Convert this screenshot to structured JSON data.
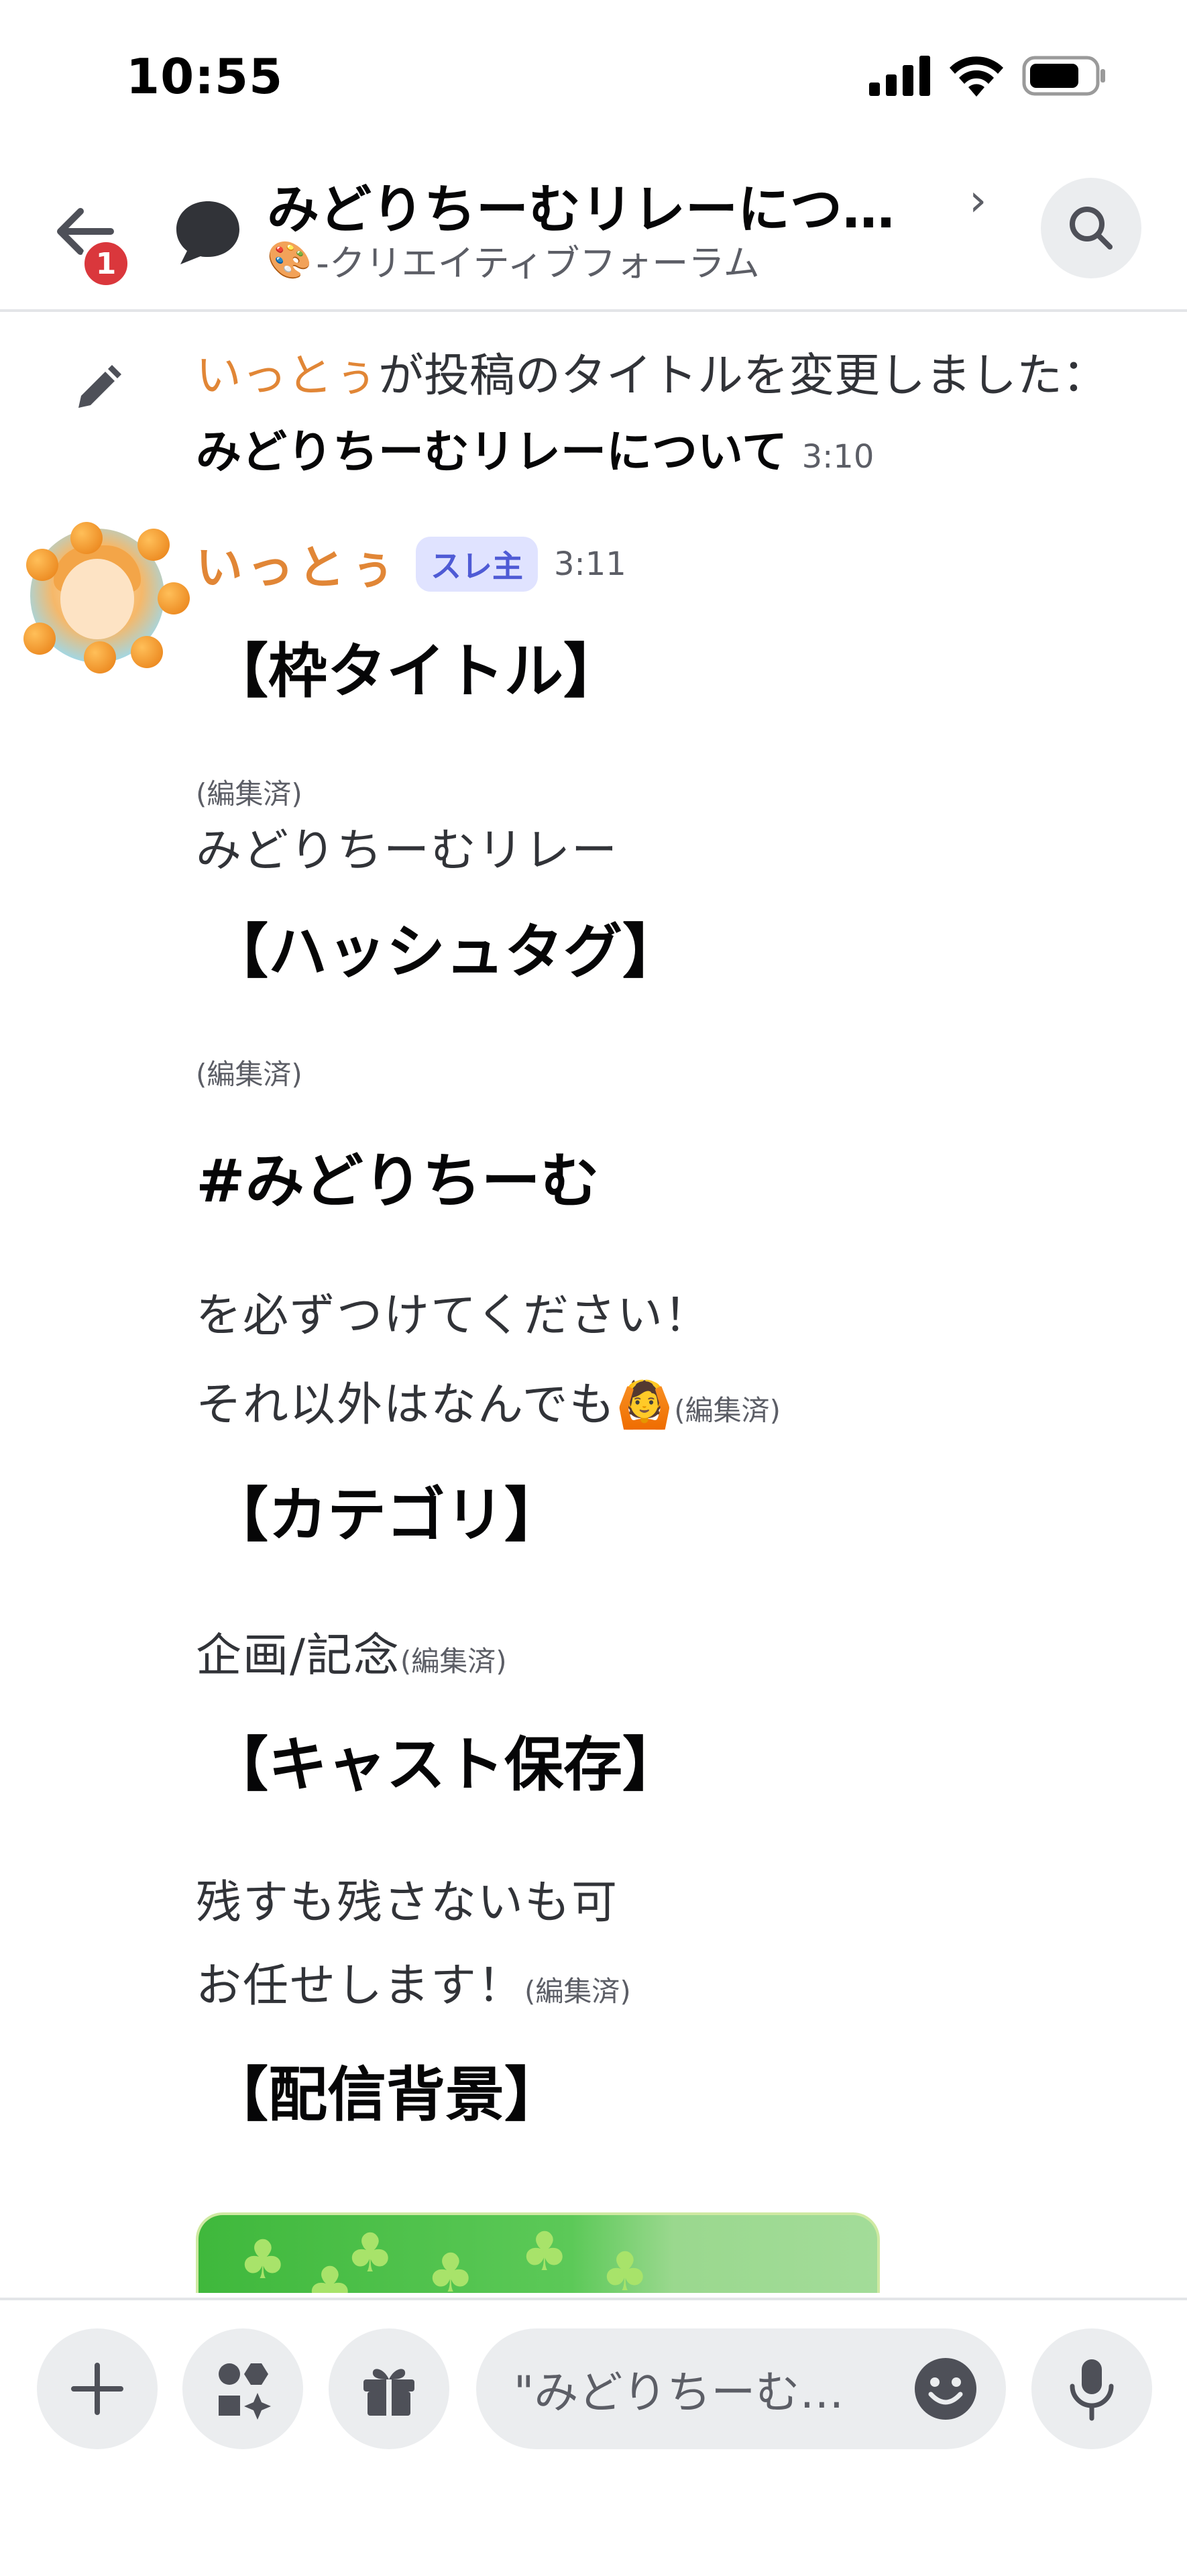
{
  "status_bar": {
    "time": "10:55",
    "icons": [
      "signal-icon",
      "wifi-icon",
      "battery-icon"
    ]
  },
  "header": {
    "back_badge": "1",
    "title": "みどりちーむリレーにつ…",
    "channel_icon": "🎨",
    "channel": "-クリエイティブフォーラム",
    "chevron": "›"
  },
  "system_message": {
    "actor": "いっとぅ",
    "action": "が投稿のタイトルを変更しました：",
    "new_title": "みどりちーむリレーについて",
    "time": "3:10"
  },
  "post": {
    "author": "いっとぅ",
    "badge": "スレ主",
    "time": "3:11",
    "edited_label": "(編集済)",
    "sections": {
      "frame_title_heading": "【枠タイトル】",
      "frame_title_value": "みどりちーむリレー",
      "hashtag_heading": "【ハッシュタグ】",
      "hashtag_value": "#みどりちーむ",
      "hashtag_note1": "を必ずつけてください！",
      "hashtag_note2": "それ以外はなんでも",
      "hashtag_emoji": "🙆",
      "category_heading": "【カテゴリ】",
      "category_value": "企画/記念",
      "cast_heading": "【キャスト保存】",
      "cast_line1": "残すも残さないも可",
      "cast_line2": "お任せします！",
      "background_heading": "【配信背景】"
    }
  },
  "composer": {
    "placeholder": "\"みどりちーむ…",
    "colors": {
      "accent": "#e18636",
      "badge_bg": "#e0e3ff",
      "badge_fg": "#4f5bd5"
    }
  }
}
